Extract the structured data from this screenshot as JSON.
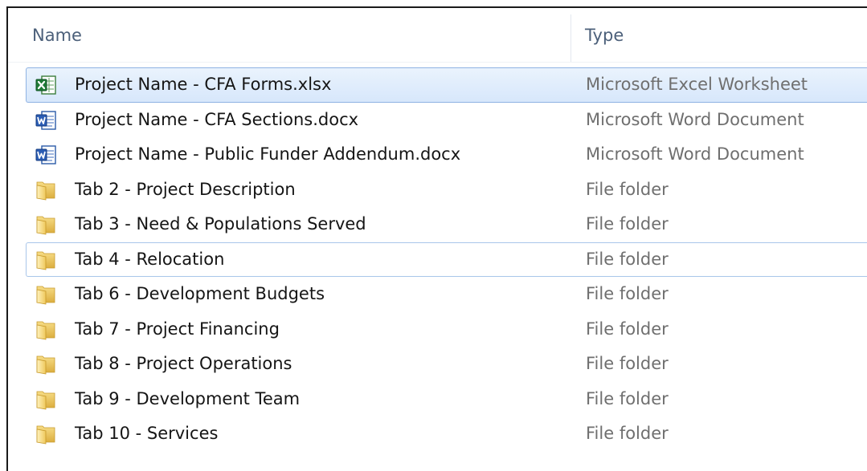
{
  "columns": {
    "name": "Name",
    "type": "Type"
  },
  "files": [
    {
      "name": "Project Name - CFA Forms.xlsx",
      "type": "Microsoft Excel Worksheet",
      "icon": "excel-icon",
      "state": "selected"
    },
    {
      "name": "Project Name - CFA Sections.docx",
      "type": "Microsoft Word Document",
      "icon": "word-icon",
      "state": "normal"
    },
    {
      "name": "Project Name - Public Funder Addendum.docx",
      "type": "Microsoft Word Document",
      "icon": "word-icon",
      "state": "normal"
    },
    {
      "name": "Tab 2 - Project Description",
      "type": "File folder",
      "icon": "folder-icon",
      "state": "normal"
    },
    {
      "name": "Tab 3 - Need & Populations Served",
      "type": "File folder",
      "icon": "folder-icon",
      "state": "normal"
    },
    {
      "name": "Tab 4 - Relocation",
      "type": "File folder",
      "icon": "folder-icon",
      "state": "focused"
    },
    {
      "name": "Tab 6 - Development Budgets",
      "type": "File folder",
      "icon": "folder-icon",
      "state": "normal"
    },
    {
      "name": "Tab 7 - Project Financing",
      "type": "File folder",
      "icon": "folder-icon",
      "state": "normal"
    },
    {
      "name": "Tab 8 - Project Operations",
      "type": "File folder",
      "icon": "folder-icon",
      "state": "normal"
    },
    {
      "name": "Tab 9 - Development Team",
      "type": "File folder",
      "icon": "folder-icon",
      "state": "normal"
    },
    {
      "name": "Tab 10 - Services",
      "type": "File folder",
      "icon": "folder-icon",
      "state": "normal"
    }
  ],
  "colors": {
    "selection_top": "#eaf3fd",
    "selection_bottom": "#d7e7fb",
    "selection_border": "#8fb3e3",
    "header_text": "#4c607a",
    "type_text": "#6f6f6f"
  }
}
